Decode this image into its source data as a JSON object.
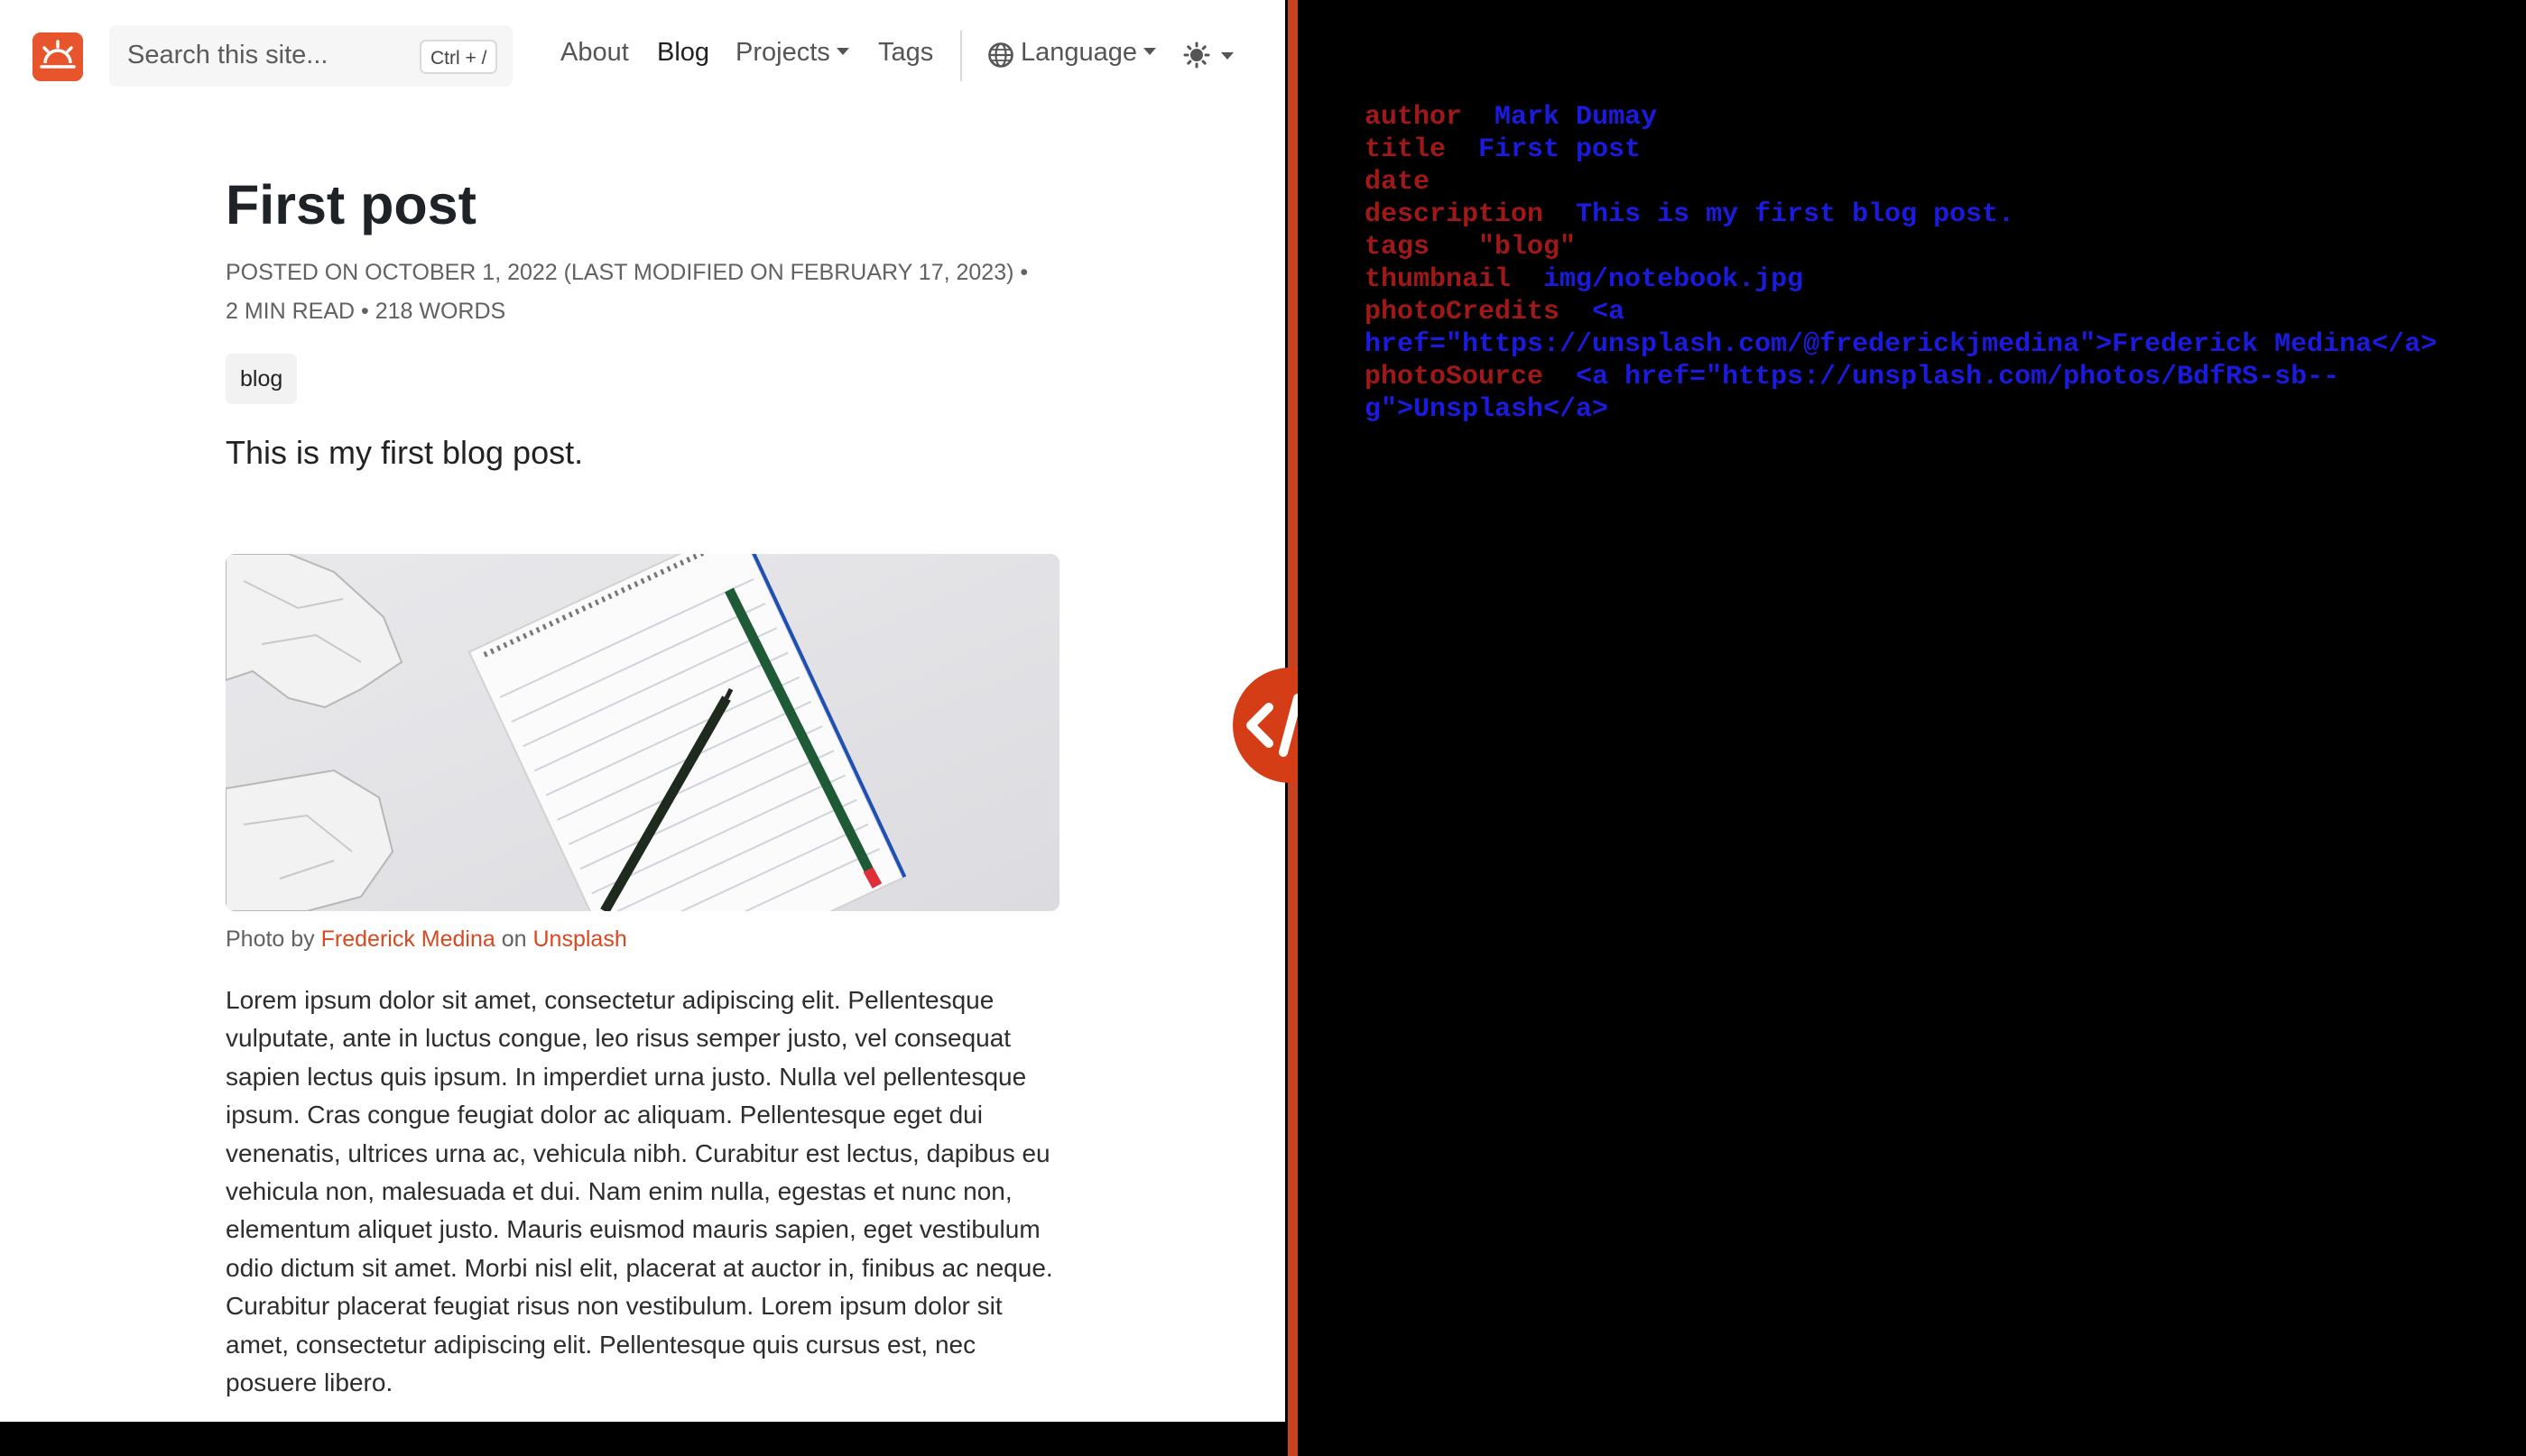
{
  "navbar": {
    "search_placeholder": "Search this site...",
    "search_shortcut": "Ctrl + /",
    "links": [
      "About",
      "Blog",
      "Projects",
      "Tags"
    ],
    "active_link": "Blog",
    "language_label": "Language"
  },
  "post": {
    "title": "First post",
    "meta_line1": "POSTED ON OCTOBER 1, 2022 (LAST MODIFIED ON FEBRUARY 17, 2023) •",
    "meta_line2": "2 MIN READ • 218 WORDS",
    "tag": "blog",
    "description": "This is my first blog post.",
    "photo_credit_prefix": "Photo by",
    "photo_credit_author": "Frederick Medina",
    "photo_credit_on": "on",
    "photo_credit_source": "Unsplash",
    "body": "Lorem ipsum dolor sit amet, consectetur adipiscing elit. Pellentesque vulputate, ante in luctus congue, leo risus semper justo, vel consequat sapien lectus quis ipsum. In imperdiet urna justo. Nulla vel pellentesque ipsum. Cras congue feugiat dolor ac aliquam. Pellentesque eget dui venenatis, ultrices urna ac, vehicula nibh. Curabitur est lectus, dapibus eu vehicula non, malesuada et dui. Nam enim nulla, egestas et nunc non, elementum aliquet justo. Mauris euismod mauris sapien, eget vestibulum odio dictum sit amet. Morbi nisl elit, placerat at auctor in, finibus ac neque. Curabitur placerat feugiat risus non vestibulum. Lorem ipsum dolor sit amet, consectetur adipiscing elit. Pellentesque quis cursus est, nec posuere libero."
  },
  "frontmatter": {
    "author_key": "author",
    "author_val": "Mark Dumay",
    "title_key": "title",
    "title_val": "First post",
    "date_key": "date",
    "description_key": "description",
    "description_val": "This is my first blog post.",
    "tags_key": "tags",
    "tags_val": "\"blog\"",
    "thumbnail_key": "thumbnail",
    "thumbnail_val": "img/notebook.jpg",
    "photoCredits_key": "photoCredits",
    "photoCredits_val1": "<a",
    "photoCredits_val2": "href=\"https://unsplash.com/@frederickjmedina\">Frederick Medina</a>",
    "photoSource_key": "photoSource",
    "photoSource_val1": "<a href=\"https://unsplash.com/photos/BdfRS-sb--",
    "photoSource_val2": "g\">Unsplash</a>"
  },
  "colors": {
    "accent": "#e8542b",
    "split_bar": "#c7421f",
    "fm_key": "#a01818",
    "fm_value": "#1b1be0"
  },
  "icons": [
    "sun-logo-icon",
    "globe-icon",
    "sun-theme-icon",
    "code-toggle-icon"
  ]
}
